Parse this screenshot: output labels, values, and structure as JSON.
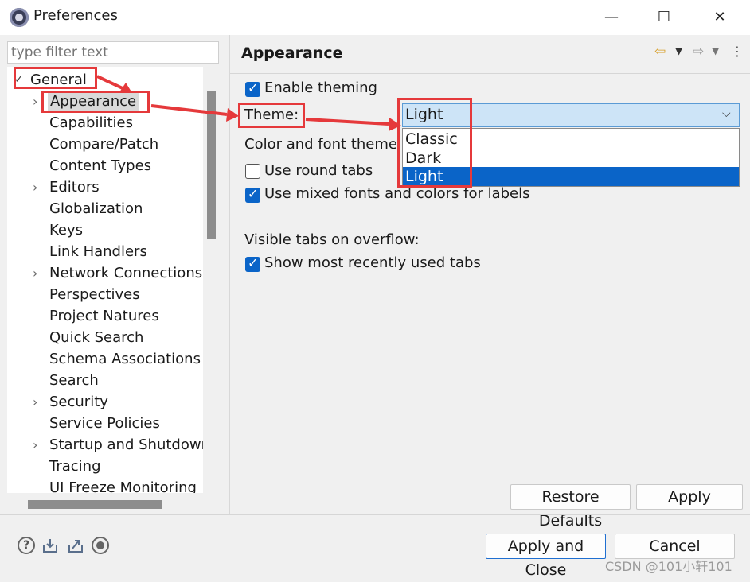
{
  "window": {
    "title": "Preferences",
    "controls": {
      "minimize": "—",
      "maximize": "☐",
      "close": "✕"
    }
  },
  "filter": {
    "placeholder": "type filter text"
  },
  "tree": {
    "items": [
      {
        "label": "General",
        "expanded": true,
        "level": 0
      },
      {
        "label": "Appearance",
        "has_children": true,
        "selected": true,
        "level": 1
      },
      {
        "label": "Capabilities",
        "level": 1
      },
      {
        "label": "Compare/Patch",
        "level": 1
      },
      {
        "label": "Content Types",
        "level": 1
      },
      {
        "label": "Editors",
        "has_children": true,
        "level": 1
      },
      {
        "label": "Globalization",
        "level": 1
      },
      {
        "label": "Keys",
        "level": 1
      },
      {
        "label": "Link Handlers",
        "level": 1
      },
      {
        "label": "Network Connections",
        "has_children": true,
        "level": 1
      },
      {
        "label": "Perspectives",
        "level": 1
      },
      {
        "label": "Project Natures",
        "level": 1
      },
      {
        "label": "Quick Search",
        "level": 1
      },
      {
        "label": "Schema Associations",
        "level": 1
      },
      {
        "label": "Search",
        "level": 1
      },
      {
        "label": "Security",
        "has_children": true,
        "level": 1
      },
      {
        "label": "Service Policies",
        "level": 1
      },
      {
        "label": "Startup and Shutdown",
        "has_children": true,
        "level": 1
      },
      {
        "label": "Tracing",
        "level": 1
      },
      {
        "label": "UI Freeze Monitoring",
        "level": 1
      }
    ]
  },
  "page": {
    "heading": "Appearance",
    "enable_theming": {
      "label": "Enable theming",
      "checked": true
    },
    "theme": {
      "label": "Theme:",
      "value": "Light",
      "options": [
        "Classic",
        "Dark",
        "Light"
      ]
    },
    "color_font_theme": {
      "label": "Color and font theme:"
    },
    "round_tabs": {
      "label": "Use round tabs",
      "checked": false
    },
    "mixed_fonts": {
      "label": "Use mixed fonts and colors for labels",
      "checked": true
    },
    "visible_tabs_label": "Visible tabs on overflow:",
    "recent_tabs": {
      "label": "Show most recently used tabs",
      "checked": true
    },
    "restore_defaults": "Restore Defaults",
    "apply": "Apply"
  },
  "footer": {
    "apply_and_close": "Apply and Close",
    "cancel": "Cancel",
    "icons": [
      "help-icon",
      "import-icon",
      "export-icon",
      "record-icon"
    ]
  },
  "watermark": "CSDN @101小轩101",
  "colors": {
    "accent": "#0a64c8",
    "annotation": "#e5393b",
    "selection": "#cde4f7"
  }
}
